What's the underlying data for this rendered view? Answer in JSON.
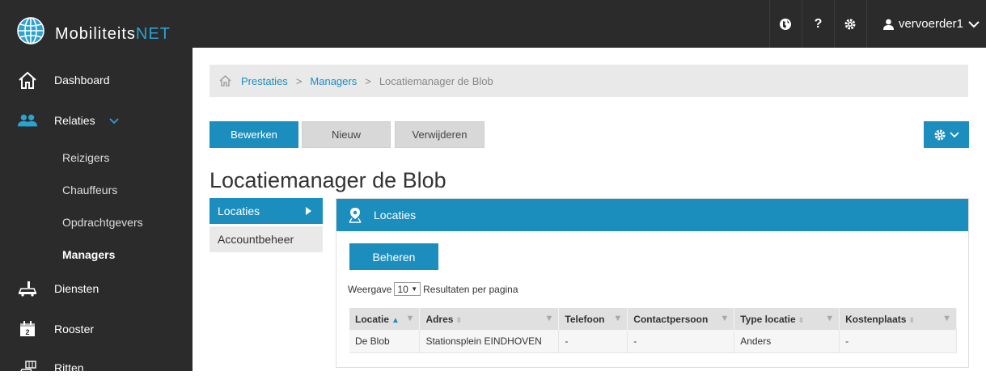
{
  "brand": {
    "name_main": "Mobiliteits",
    "name_accent": "NET"
  },
  "topbar": {
    "user": "vervoerder1"
  },
  "sidebar": {
    "items": [
      {
        "label": "Dashboard"
      },
      {
        "label": "Relaties"
      },
      {
        "label": "Diensten"
      },
      {
        "label": "Rooster"
      },
      {
        "label": "Ritten"
      }
    ],
    "subitems": [
      {
        "label": "Reizigers"
      },
      {
        "label": "Chauffeurs"
      },
      {
        "label": "Opdrachtgevers"
      },
      {
        "label": "Managers"
      }
    ]
  },
  "breadcrumb": {
    "items": [
      "Prestaties",
      "Managers",
      "Locatiemanager de Blob"
    ]
  },
  "actions": {
    "edit": "Bewerken",
    "new": "Nieuw",
    "delete": "Verwijderen"
  },
  "page": {
    "title": "Locatiemanager de Blob"
  },
  "tabs": [
    {
      "label": "Locaties"
    },
    {
      "label": "Accountbeheer"
    }
  ],
  "panel": {
    "title": "Locaties",
    "manage_button": "Beheren",
    "show_label": "Weergave",
    "page_size": "10",
    "per_page_label": "Resultaten per pagina"
  },
  "table": {
    "columns": [
      "Locatie",
      "Adres",
      "Telefoon",
      "Contactpersoon",
      "Type locatie",
      "Kostenplaats"
    ],
    "rows": [
      [
        "De Blob",
        "Stationsplein EINDHOVEN",
        "-",
        "-",
        "Anders",
        "-"
      ]
    ]
  },
  "colors": {
    "accent": "#1c8ebd",
    "sidebar": "#2b2b2b",
    "brand_accent": "#2aa3d1"
  }
}
